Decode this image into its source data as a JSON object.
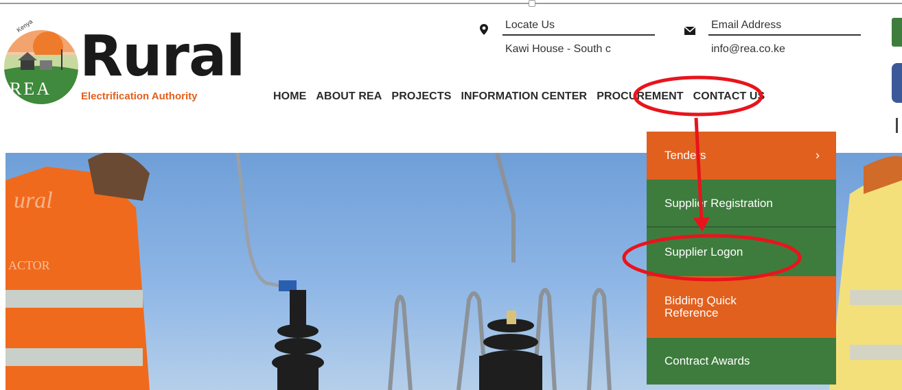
{
  "logo": {
    "word": "Rural",
    "subtitle": "Electrification Authority",
    "emblem_text": "REA",
    "arc_text": "Kenya"
  },
  "contact": {
    "location": {
      "title": "Locate Us",
      "value": "Kawi House - South c",
      "icon": "map-pin-icon"
    },
    "email": {
      "title": "Email Address",
      "value": "info@rea.co.ke",
      "icon": "envelope-icon"
    }
  },
  "nav": {
    "items": [
      "HOME",
      "ABOUT REA",
      "PROJECTS",
      "INFORMATION CENTER",
      "PROCUREMENT",
      "CONTACT US"
    ]
  },
  "dropdown": {
    "items": [
      {
        "label": "Tenders",
        "color": "orange",
        "has_submenu": true
      },
      {
        "label": "Supplier Registration",
        "color": "green",
        "has_submenu": false
      },
      {
        "label": "Supplier Logon",
        "color": "green",
        "has_submenu": false
      },
      {
        "label": "Bidding Quick Reference",
        "color": "orange",
        "has_submenu": false
      },
      {
        "label": "Contract Awards",
        "color": "green",
        "has_submenu": false
      }
    ]
  },
  "hero": {
    "vest_text_left_1": "ural",
    "vest_text_left_2": "ACTOR"
  },
  "colors": {
    "orange": "#e1601e",
    "green": "#3e7c3d",
    "annotation_red": "#e8141c",
    "sky": "#8eb6e6"
  }
}
